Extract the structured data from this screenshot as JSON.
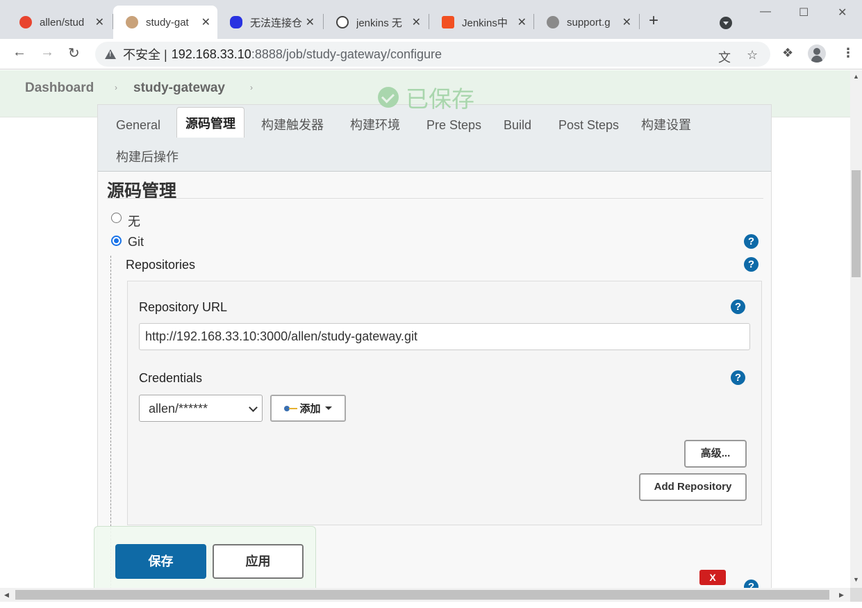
{
  "browser": {
    "tabs": [
      {
        "title": "allen/stud",
        "favicon_color": "#e8442f"
      },
      {
        "title": "study-gat",
        "favicon_color": "#8a6a4f",
        "active": true
      },
      {
        "title": "无法连接仓",
        "favicon_color": "#2932e1"
      },
      {
        "title": "jenkins 无",
        "favicon_color": "#444444"
      },
      {
        "title": "Jenkins中",
        "favicon_color": "#f25022"
      },
      {
        "title": "support.g",
        "favicon_color": "#8a8a8a"
      }
    ],
    "close_glyph": "✕",
    "new_tab_glyph": "+",
    "window": {
      "minimize": "—",
      "maximize": "☐",
      "close": "✕"
    },
    "insecure_label": "不安全 |",
    "url_host": "192.168.33.10",
    "url_path": ":8888/job/study-gateway/configure",
    "icons": [
      "back-icon",
      "forward-icon",
      "reload-icon",
      "translate-icon",
      "star-icon",
      "extensions-icon",
      "profile-icon",
      "menu-icon"
    ]
  },
  "breadcrumbs": {
    "items": [
      "Dashboard",
      "study-gateway"
    ],
    "separator": "›"
  },
  "saved_banner": {
    "text": "已保存",
    "color": "#a9d6ad"
  },
  "config_tabs": [
    {
      "label": "General"
    },
    {
      "label": "源码管理",
      "active": true
    },
    {
      "label": "构建触发器"
    },
    {
      "label": "构建环境"
    },
    {
      "label": "Pre Steps"
    },
    {
      "label": "Build"
    },
    {
      "label": "Post Steps"
    },
    {
      "label": "构建设置"
    },
    {
      "label": "构建后操作"
    }
  ],
  "scm": {
    "title": "源码管理",
    "option_none": "无",
    "option_git": "Git",
    "selected": "Git",
    "repositories_label": "Repositories",
    "repo_url_label": "Repository URL",
    "repo_url_value": "http://192.168.33.10:3000/allen/study-gateway.git",
    "credentials_label": "Credentials",
    "credentials_value": "allen/******",
    "add_button": "添加",
    "advanced_button": "高级...",
    "add_repository_button": "Add Repository",
    "delete_button": "X",
    "help_glyph": "?"
  },
  "bottom_bar": {
    "save": "保存",
    "apply": "应用"
  },
  "colors": {
    "primary": "#0f6aa6",
    "help": "#0e6aa8",
    "danger": "#d01e1e",
    "breadcrumb_bg": "#e9f3ea"
  }
}
